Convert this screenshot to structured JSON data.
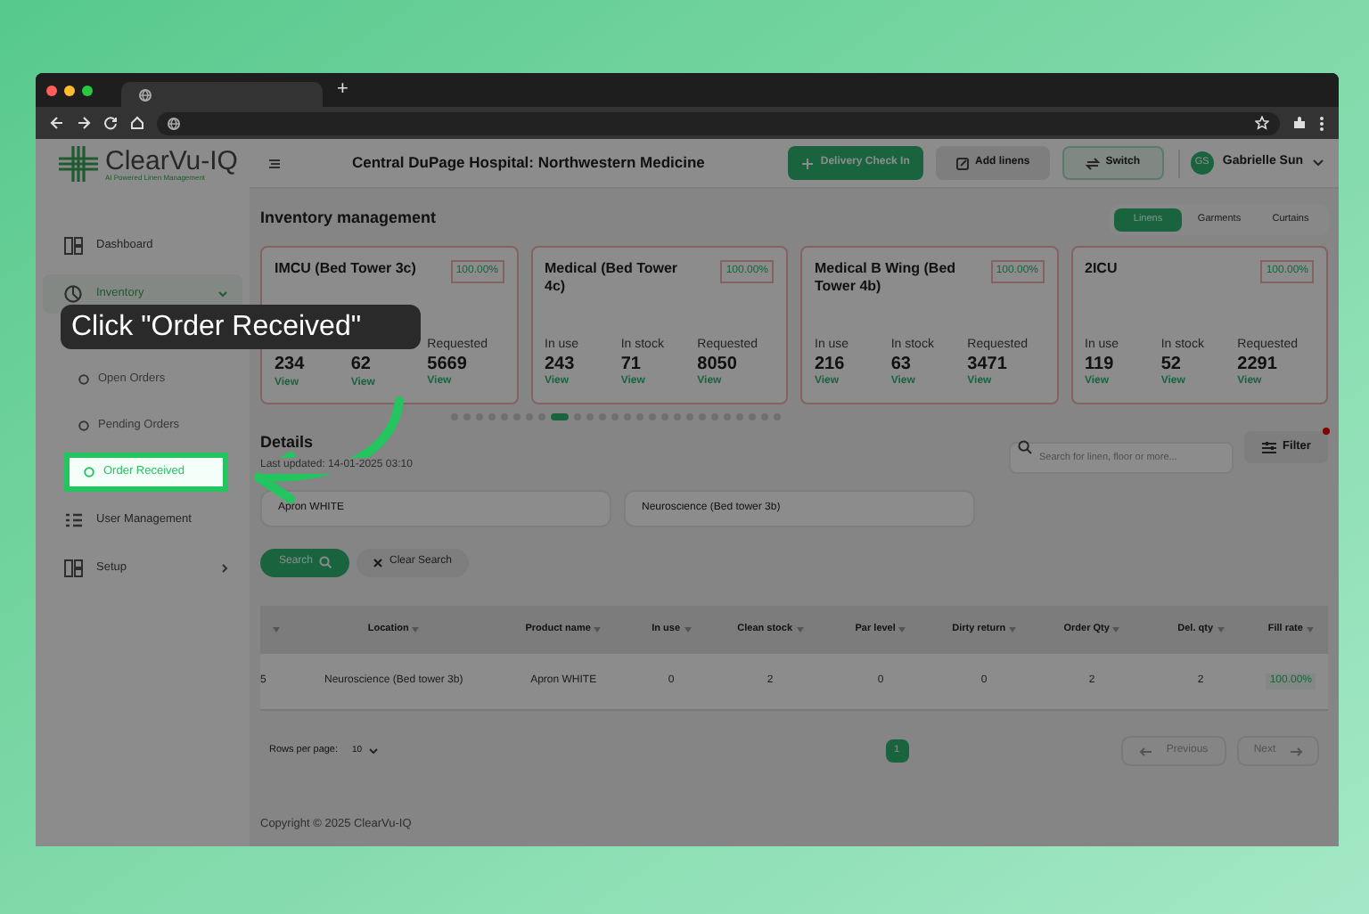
{
  "browser": {
    "new_tab": "+"
  },
  "app": {
    "logo": {
      "name": "ClearVu-IQ",
      "tagline": "AI Powered Linen Management"
    },
    "sidebar": [
      {
        "label": "Dashboard",
        "kind": "item",
        "selected": false
      },
      {
        "label": "Inventory",
        "kind": "group",
        "selected": true
      },
      {
        "label": "Open Orders",
        "kind": "sub",
        "selected": false
      },
      {
        "label": "Pending Orders",
        "kind": "sub",
        "selected": false
      },
      {
        "label": "Order Received",
        "kind": "sub",
        "selected": true
      },
      {
        "label": "User Management",
        "kind": "item",
        "selected": false
      },
      {
        "label": "Setup",
        "kind": "expandable",
        "selected": false
      }
    ],
    "header": {
      "title": "Central DuPage Hospital: Northwestern Medicine",
      "buttons": [
        {
          "label": "Delivery Check In",
          "kind": "primary"
        },
        {
          "label": "Add linens",
          "kind": "gray"
        },
        {
          "label": "Switch",
          "kind": "outline"
        }
      ],
      "user": {
        "initials": "GS",
        "name": "Gabrielle Sun"
      }
    },
    "section_title": "Inventory management",
    "tabs": [
      {
        "label": "Linens",
        "selected": true
      },
      {
        "label": "Garments",
        "selected": false
      },
      {
        "label": "Curtains",
        "selected": false
      }
    ],
    "cards": [
      {
        "title": "IMCU (Bed Tower 3c)",
        "rate": "100.00%",
        "stats": [
          {
            "value": "234",
            "link": "View"
          },
          {
            "value": "62",
            "link": "View"
          },
          {
            "label": "Requested",
            "value": "5669",
            "link": "View"
          }
        ]
      },
      {
        "title": "Medical (Bed Tower 4c)",
        "rate": "100.00%",
        "stats": [
          {
            "label": "In use",
            "value": "243",
            "link": "View"
          },
          {
            "label": "In stock",
            "value": "71",
            "link": "View"
          },
          {
            "label": "Requested",
            "value": "8050",
            "link": "View"
          }
        ]
      },
      {
        "title": "Medical B Wing (Bed Tower 4b)",
        "rate": "100.00%",
        "stats": [
          {
            "label": "In use",
            "value": "216",
            "link": "View"
          },
          {
            "label": "In stock",
            "value": "63",
            "link": "View"
          },
          {
            "label": "Requested",
            "value": "3471",
            "link": "View"
          }
        ]
      },
      {
        "title": "2ICU",
        "rate": "100.00%",
        "stats": [
          {
            "label": "In use",
            "value": "119",
            "link": "View"
          },
          {
            "label": "In stock",
            "value": "52",
            "link": "View"
          },
          {
            "label": "Requested",
            "value": "2291",
            "link": "View"
          }
        ]
      }
    ],
    "carousel_dots": [
      {
        "selected": false
      },
      {
        "selected": false
      },
      {
        "selected": false
      },
      {
        "selected": false
      },
      {
        "selected": false
      },
      {
        "selected": false
      },
      {
        "selected": false
      },
      {
        "selected": false
      },
      {
        "selected": true
      },
      {
        "selected": false
      },
      {
        "selected": false
      },
      {
        "selected": false
      },
      {
        "selected": false
      },
      {
        "selected": false
      },
      {
        "selected": false
      },
      {
        "selected": false
      },
      {
        "selected": false
      },
      {
        "selected": false
      },
      {
        "selected": false
      },
      {
        "selected": false
      },
      {
        "selected": false
      },
      {
        "selected": false
      },
      {
        "selected": false
      },
      {
        "selected": false
      },
      {
        "selected": false
      },
      {
        "selected": false
      }
    ],
    "details": {
      "title": "Details",
      "updated": "Last updated: 14-01-2025 03:10",
      "search": {
        "placeholder": "Search for linen, floor or more..."
      },
      "filter": {
        "label": "Filter",
        "active": true
      },
      "filters": [
        {
          "value": "Apron WHITE"
        },
        {
          "value": "Neuroscience (Bed tower 3b)"
        }
      ],
      "search_button": "Search",
      "clear_button": "Clear Search"
    },
    "table": {
      "columns": [
        "",
        "Location",
        "Product name",
        "In use",
        "Clean stock",
        "Par level",
        "Dirty return",
        "Order Qty",
        "Del. qty",
        "Fill rate"
      ],
      "rows": [
        {
          "cells": [
            "5",
            "Neuroscience (Bed tower 3b)",
            "Apron WHITE",
            "0",
            "2",
            "0",
            "0",
            "2",
            "2",
            "100.00%"
          ]
        }
      ]
    },
    "pagination": {
      "rows_label": "Rows per page:",
      "rows_value": "10",
      "pages": [
        {
          "label": "1",
          "selected": true
        }
      ],
      "previous": "Previous",
      "next": "Next"
    },
    "footer": "Copyright © 2025 ClearVu-IQ"
  },
  "tooltip": {
    "text": "Click \"Order Received\""
  }
}
